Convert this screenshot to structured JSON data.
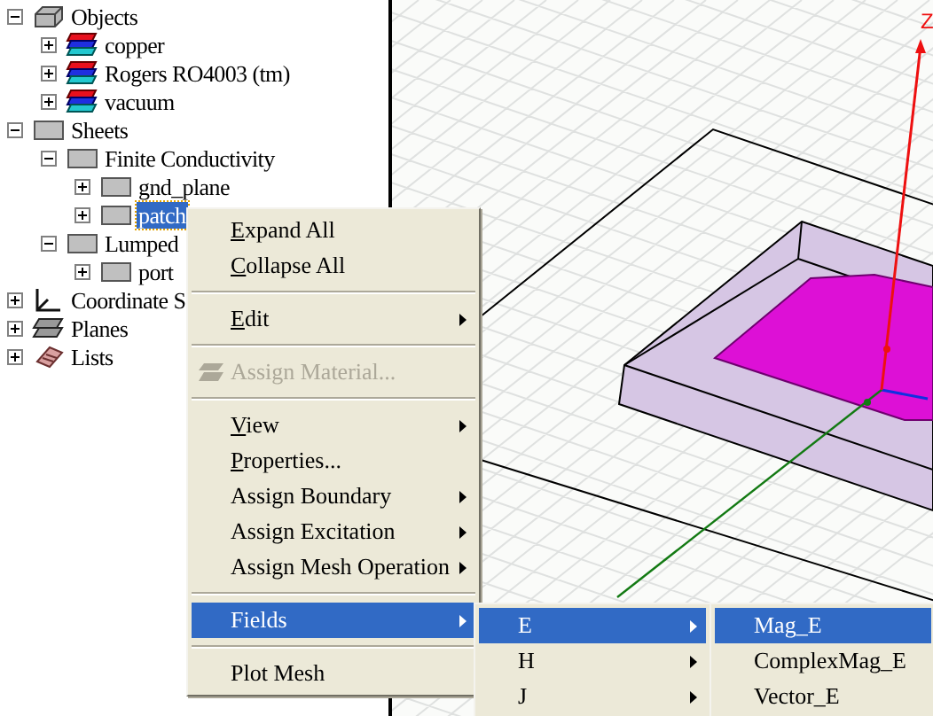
{
  "tree": [
    {
      "label": "Objects",
      "kind": "solids",
      "expanded": true,
      "selected": false,
      "children": [
        {
          "label": "copper",
          "kind": "material",
          "expanded": false,
          "selected": false
        },
        {
          "label": "Rogers RO4003 (tm)",
          "kind": "material",
          "expanded": false,
          "selected": false
        },
        {
          "label": "vacuum",
          "kind": "material",
          "expanded": false,
          "selected": false
        }
      ]
    },
    {
      "label": "Sheets",
      "kind": "sheet",
      "expanded": true,
      "selected": false,
      "children": [
        {
          "label": "Finite Conductivity",
          "kind": "sheet",
          "expanded": true,
          "selected": false,
          "children": [
            {
              "label": "gnd_plane",
              "kind": "sheet",
              "expanded": false,
              "selected": false
            },
            {
              "label": "patch",
              "kind": "sheet",
              "expanded": false,
              "selected": true
            }
          ]
        },
        {
          "label": "Lumped",
          "kind": "sheet",
          "expanded": true,
          "selected": false,
          "children": [
            {
              "label": "port",
              "kind": "sheet",
              "expanded": false,
              "selected": false
            }
          ]
        }
      ]
    },
    {
      "label": "Coordinate S",
      "kind": "axes",
      "expanded": false,
      "selected": false
    },
    {
      "label": "Planes",
      "kind": "planes",
      "expanded": false,
      "selected": false
    },
    {
      "label": "Lists",
      "kind": "lists",
      "expanded": false,
      "selected": false
    }
  ],
  "context_menu": {
    "items": [
      {
        "kind": "item",
        "label": "Expand All",
        "underline_first": true,
        "submenu": false,
        "disabled": false,
        "selected": false
      },
      {
        "kind": "item",
        "label": "Collapse All",
        "underline_first": true,
        "submenu": false,
        "disabled": false,
        "selected": false
      },
      {
        "kind": "separator"
      },
      {
        "kind": "item",
        "label": "Edit",
        "underline_first": true,
        "submenu": true,
        "disabled": false,
        "selected": false
      },
      {
        "kind": "separator"
      },
      {
        "kind": "item",
        "label": "Assign Material...",
        "underline_first": false,
        "submenu": false,
        "disabled": true,
        "selected": false,
        "icon": true
      },
      {
        "kind": "separator"
      },
      {
        "kind": "item",
        "label": "View",
        "underline_first": true,
        "submenu": true,
        "disabled": false,
        "selected": false
      },
      {
        "kind": "item",
        "label": "Properties...",
        "underline_first": true,
        "submenu": false,
        "disabled": false,
        "selected": false
      },
      {
        "kind": "item",
        "label": "Assign Boundary",
        "underline_first": false,
        "submenu": true,
        "disabled": false,
        "selected": false
      },
      {
        "kind": "item",
        "label": "Assign Excitation",
        "underline_first": false,
        "submenu": true,
        "disabled": false,
        "selected": false
      },
      {
        "kind": "item",
        "label": "Assign Mesh Operation",
        "underline_first": false,
        "submenu": true,
        "disabled": false,
        "selected": false
      },
      {
        "kind": "separator"
      },
      {
        "kind": "item",
        "label": "Fields",
        "underline_first": false,
        "submenu": true,
        "disabled": false,
        "selected": true
      },
      {
        "kind": "separator"
      },
      {
        "kind": "item",
        "label": "Plot Mesh",
        "underline_first": false,
        "submenu": false,
        "disabled": false,
        "selected": false
      }
    ]
  },
  "fields_submenu": {
    "items": [
      {
        "kind": "item",
        "label": "E",
        "underline_first": false,
        "submenu": true,
        "disabled": false,
        "selected": true
      },
      {
        "kind": "item",
        "label": "H",
        "underline_first": false,
        "submenu": true,
        "disabled": false,
        "selected": false
      },
      {
        "kind": "item",
        "label": "J",
        "underline_first": false,
        "submenu": true,
        "disabled": false,
        "selected": false
      }
    ]
  },
  "e_submenu": {
    "items": [
      {
        "kind": "item",
        "label": "Mag_E",
        "underline_first": false,
        "submenu": false,
        "disabled": false,
        "selected": true
      },
      {
        "kind": "item",
        "label": "ComplexMag_E",
        "underline_first": false,
        "submenu": false,
        "disabled": false,
        "selected": false
      },
      {
        "kind": "item",
        "label": "Vector_E",
        "underline_first": false,
        "submenu": false,
        "disabled": false,
        "selected": false
      }
    ]
  },
  "model_view": {
    "axis_label": "Z"
  }
}
